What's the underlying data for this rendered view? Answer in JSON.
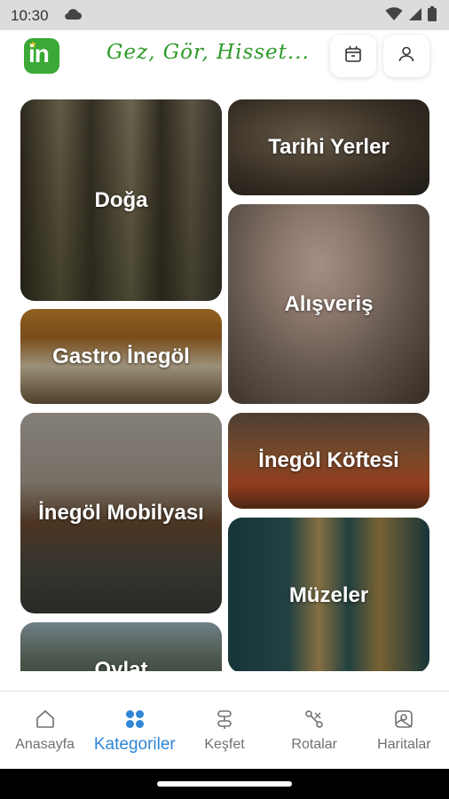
{
  "status_bar": {
    "time": "10:30"
  },
  "header": {
    "logo_text": "in",
    "slogan": "Gez, Gör, Hisset..."
  },
  "categories": [
    {
      "label": "Doğa"
    },
    {
      "label": "Tarihi Yerler"
    },
    {
      "label": "Alışveriş"
    },
    {
      "label": "Gastro İnegöl"
    },
    {
      "label": "İnegöl Mobilyası"
    },
    {
      "label": "İnegöl Köftesi"
    },
    {
      "label": "Müzeler"
    },
    {
      "label": "Oylat"
    }
  ],
  "bottom_nav": [
    {
      "label": "Anasayfa",
      "icon": "home-icon"
    },
    {
      "label": "Kategoriler",
      "icon": "grid-icon",
      "active": true
    },
    {
      "label": "Keşfet",
      "icon": "discover-icon"
    },
    {
      "label": "Rotalar",
      "icon": "route-icon"
    },
    {
      "label": "Haritalar",
      "icon": "map-icon"
    }
  ],
  "colors": {
    "brand_green": "#3aa935",
    "active_blue": "#2f86d6",
    "inactive_gray": "#707070"
  }
}
